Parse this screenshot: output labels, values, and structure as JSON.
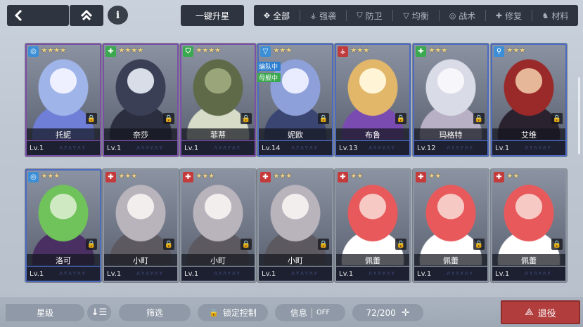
{
  "top": {
    "back_icon": "back-arrow-icon",
    "home_icon": "home-icon",
    "info_icon": "info-icon",
    "upgrade_label": "一键升星"
  },
  "tabs": [
    {
      "label": "全部",
      "icon": "all-icon",
      "glyph": "✥",
      "active": true
    },
    {
      "label": "强袭",
      "icon": "assault-icon",
      "glyph": "⚶",
      "active": false
    },
    {
      "label": "防卫",
      "icon": "defense-icon",
      "glyph": "⛉",
      "active": false
    },
    {
      "label": "均衡",
      "icon": "balance-icon",
      "glyph": "▽",
      "active": false
    },
    {
      "label": "战术",
      "icon": "tactics-icon",
      "glyph": "◎",
      "active": false
    },
    {
      "label": "修复",
      "icon": "repair-icon",
      "glyph": "✚",
      "active": false
    },
    {
      "label": "材料",
      "icon": "material-icon",
      "glyph": "♞",
      "active": false
    }
  ],
  "cards": [
    {
      "name": "托妮",
      "level": "Lv.1",
      "role": "tactics",
      "stars": "★★★★",
      "frame": "purple",
      "tags": []
    },
    {
      "name": "奈莎",
      "level": "Lv.1",
      "role": "repair",
      "stars": "★★★★",
      "frame": "purple",
      "tags": []
    },
    {
      "name": "菲蒂",
      "level": "Lv.1",
      "role": "defense",
      "stars": "★★★★",
      "frame": "purple",
      "tags": []
    },
    {
      "name": "妮欧",
      "level": "Lv.14",
      "role": "balance",
      "stars": "★★★",
      "frame": "blue",
      "tags": [
        "编队中",
        "母舰中"
      ]
    },
    {
      "name": "布鲁",
      "level": "Lv.13",
      "role": "assault",
      "stars": "★★★",
      "frame": "blue",
      "tags": []
    },
    {
      "name": "玛格特",
      "level": "Lv.12",
      "role": "repair",
      "stars": "★★★",
      "frame": "blue",
      "tags": []
    },
    {
      "name": "艾维",
      "level": "Lv.1",
      "role": "defense2",
      "stars": "★★★",
      "frame": "blue",
      "tags": []
    },
    {
      "name": "洛可",
      "level": "Lv.1",
      "role": "tactics",
      "stars": "★★★",
      "frame": "blue",
      "tags": []
    },
    {
      "name": "小町",
      "level": "Lv.1",
      "role": "repair-red",
      "stars": "★★★",
      "frame": "grey",
      "tags": []
    },
    {
      "name": "小町",
      "level": "Lv.1",
      "role": "repair-red",
      "stars": "★★★",
      "frame": "grey",
      "tags": []
    },
    {
      "name": "小町",
      "level": "Lv.1",
      "role": "repair-red",
      "stars": "★★★",
      "frame": "grey",
      "tags": []
    },
    {
      "name": "佩蕾",
      "level": "Lv.1",
      "role": "repair-red",
      "stars": "★★",
      "frame": "grey",
      "tags": []
    },
    {
      "name": "佩蕾",
      "level": "Lv.1",
      "role": "repair-red",
      "stars": "★★",
      "frame": "grey",
      "tags": []
    },
    {
      "name": "佩蕾",
      "level": "Lv.1",
      "role": "repair-red",
      "stars": "★★",
      "frame": "grey",
      "tags": []
    }
  ],
  "bottom": {
    "rarity_label": "星级",
    "sort_icon": "sort-icon",
    "filter_label": "筛选",
    "lock_label": "锁定控制",
    "info_label": "信息",
    "info_toggle": "OFF",
    "count": "72/200",
    "retire_label": "退役"
  },
  "colors": {
    "purple": "#7c4fa8",
    "blue": "#4d6bc2",
    "grey": "#8c95a3",
    "assault": "#c03b3b",
    "repair": "#3aa84f",
    "repair-red": "#c53a3a",
    "tactics": "#3c8fd6",
    "defense": "#3aa84f",
    "defense2": "#3c8fd6",
    "balance": "#3c8fd6"
  }
}
